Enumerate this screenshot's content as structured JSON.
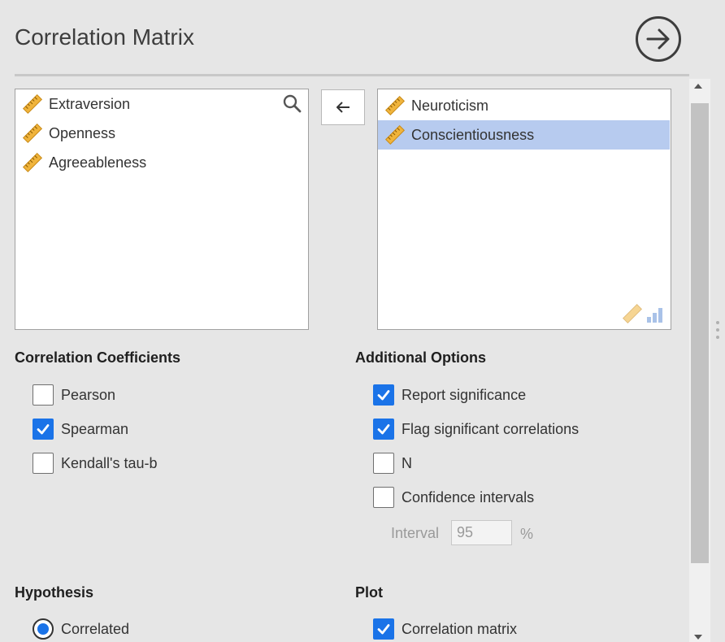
{
  "header": {
    "title": "Correlation Matrix"
  },
  "available_variables": {
    "items": [
      {
        "label": "Extraversion",
        "icon": "ruler-icon"
      },
      {
        "label": "Openness",
        "icon": "ruler-icon"
      },
      {
        "label": "Agreeableness",
        "icon": "ruler-icon"
      }
    ]
  },
  "selected_variables": {
    "items": [
      {
        "label": "Neuroticism",
        "icon": "ruler-icon",
        "selected": false
      },
      {
        "label": "Conscientiousness",
        "icon": "ruler-icon",
        "selected": true
      }
    ]
  },
  "correlation_coefficients": {
    "title": "Correlation Coefficients",
    "options": [
      {
        "label": "Pearson",
        "checked": false
      },
      {
        "label": "Spearman",
        "checked": true
      },
      {
        "label": "Kendall's tau-b",
        "checked": false
      }
    ]
  },
  "additional_options": {
    "title": "Additional Options",
    "options": [
      {
        "label": "Report significance",
        "checked": true
      },
      {
        "label": "Flag significant correlations",
        "checked": true
      },
      {
        "label": "N",
        "checked": false
      },
      {
        "label": "Confidence intervals",
        "checked": false
      }
    ],
    "interval": {
      "label": "Interval",
      "value": "95",
      "unit": "%"
    }
  },
  "hypothesis": {
    "title": "Hypothesis",
    "options": [
      {
        "label": "Correlated",
        "selected": true
      }
    ]
  },
  "plot": {
    "title": "Plot",
    "options": [
      {
        "label": "Correlation matrix",
        "checked": true
      }
    ]
  },
  "colors": {
    "accent": "#1a73e8",
    "selection": "#b7cbef",
    "ruler": "#f0b43c"
  }
}
